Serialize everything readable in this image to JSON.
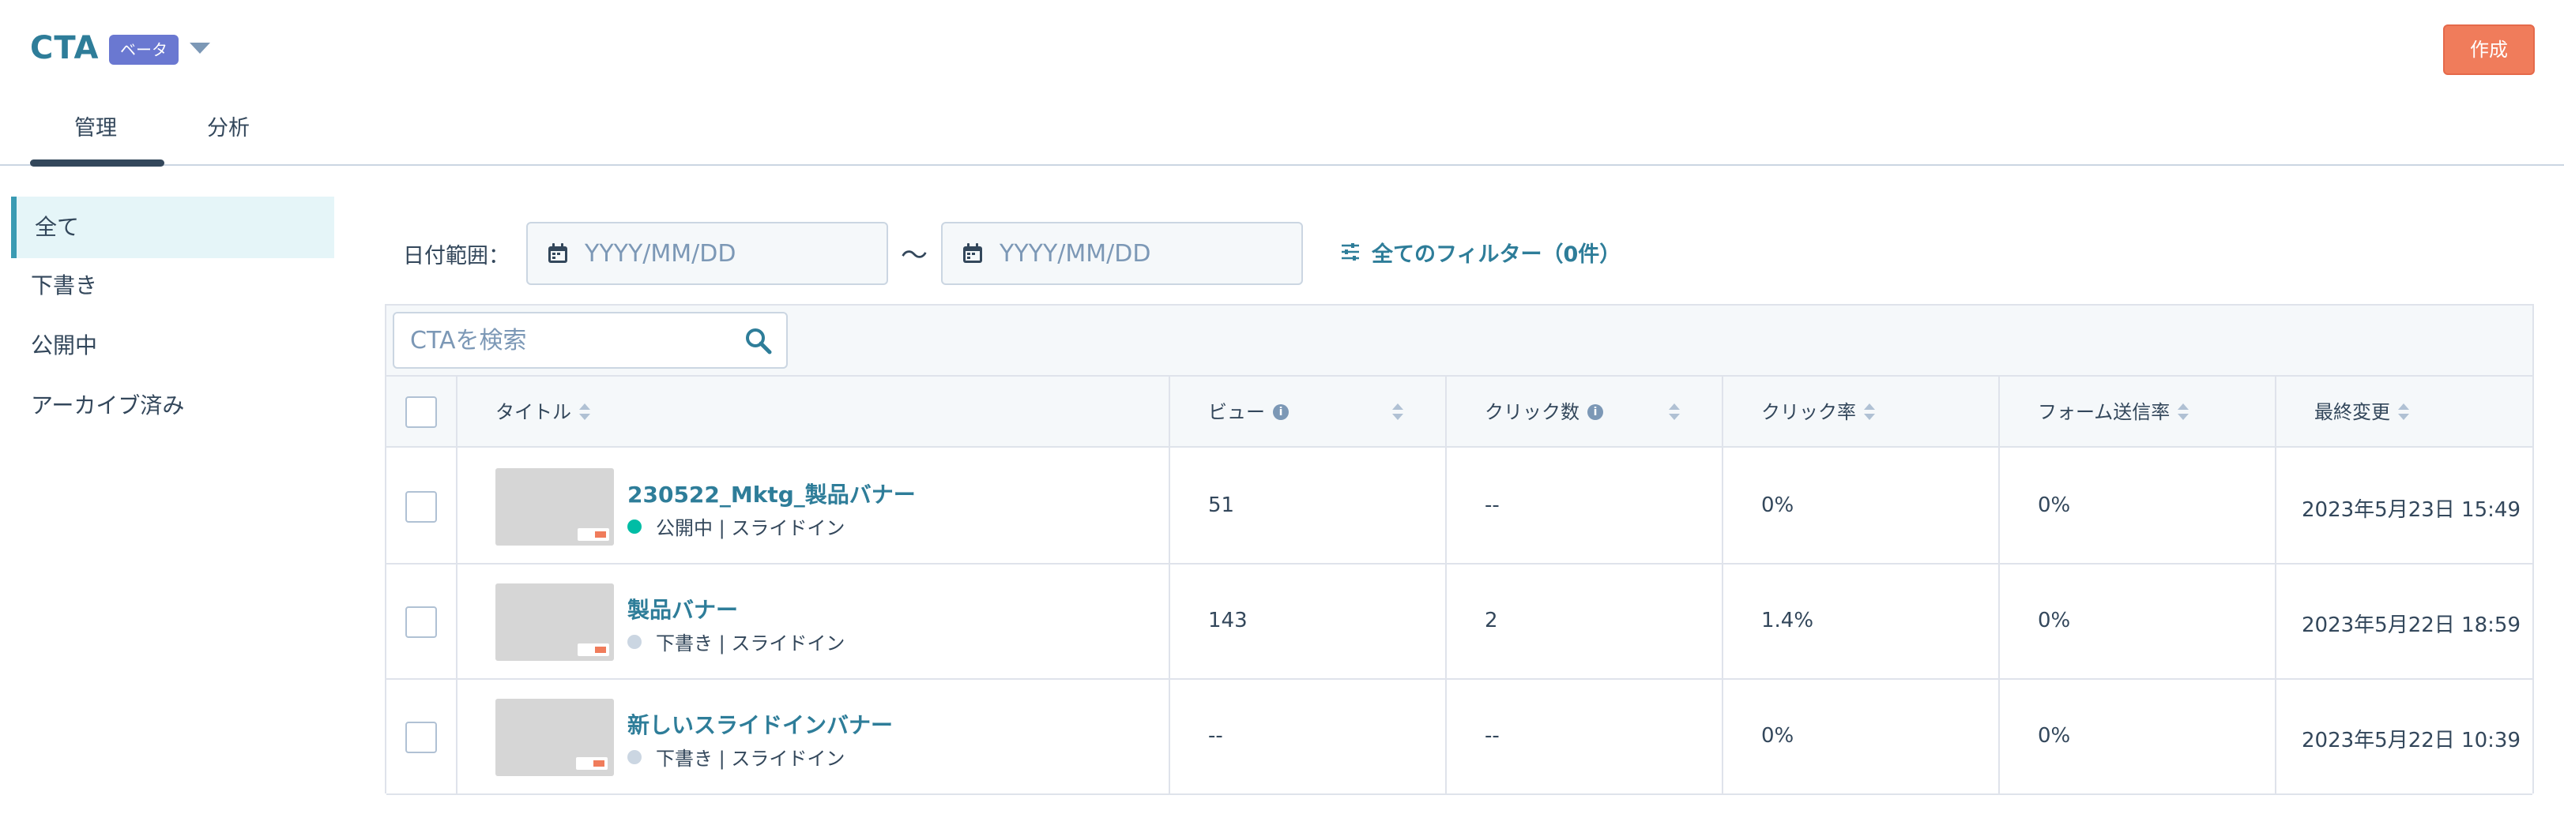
{
  "header": {
    "title": "CTA",
    "beta_badge": "ベータ",
    "create_button": "作成",
    "tabs": [
      {
        "label": "管理",
        "active": true
      },
      {
        "label": "分析",
        "active": false
      }
    ]
  },
  "sidebar": {
    "items": [
      {
        "label": "全て",
        "active": true
      },
      {
        "label": "下書き",
        "active": false
      },
      {
        "label": "公開中",
        "active": false
      },
      {
        "label": "アーカイブ済み",
        "active": false
      }
    ]
  },
  "filters": {
    "date_range_label": "日付範囲：",
    "start_placeholder": "YYYY/MM/DD",
    "separator": "〜",
    "end_placeholder": "YYYY/MM/DD",
    "all_filters_label": "全てのフィルター（0件）"
  },
  "search": {
    "placeholder": "CTAを検索"
  },
  "table": {
    "columns": [
      "タイトル",
      "ビュー",
      "クリック数",
      "クリック率",
      "フォーム送信率",
      "最終変更"
    ],
    "rows": [
      {
        "title": "230522_Mktg_製品バナー",
        "status": "公開中 | スライドイン",
        "status_color": "#00bda5",
        "views": "51",
        "clicks": "--",
        "click_rate": "0%",
        "form_rate": "0%",
        "last_modified": "2023年5月23日 15:49"
      },
      {
        "title": "製品バナー",
        "status": "下書き | スライドイン",
        "status_color": "#cbd6e2",
        "views": "143",
        "clicks": "2",
        "click_rate": "1.4%",
        "form_rate": "0%",
        "last_modified": "2023年5月22日 18:59"
      },
      {
        "title": "新しいスライドインバナー",
        "status": "下書き | スライドイン",
        "status_color": "#cbd6e2",
        "views": "--",
        "clicks": "--",
        "click_rate": "0%",
        "form_rate": "0%",
        "last_modified": "2023年5月22日 10:39"
      }
    ]
  },
  "colors": {
    "accent": "#2e7d99",
    "create": "#f07c5b",
    "beta": "#6a78d1"
  }
}
